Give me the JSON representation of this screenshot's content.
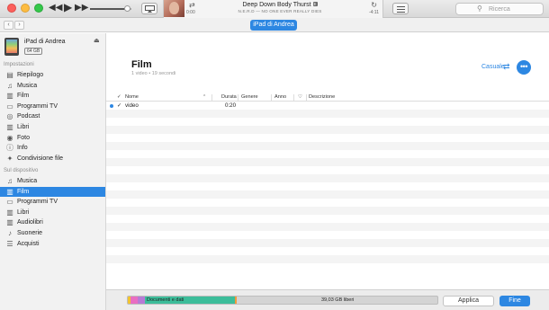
{
  "player": {
    "song_title": "Deep Down Body Thurst",
    "song_badge": "E",
    "artist_album": "N.E.R.D — NO ONE EVER REALLY DIES",
    "time_elapsed": "0:00",
    "time_remaining": "-4:11",
    "volume_fraction": 0.87,
    "search_placeholder": "Ricerca",
    "icons": [
      "rewind-icon",
      "play-icon",
      "fast-forward-icon",
      "airplay-icon",
      "shuffle-icon",
      "repeat-icon",
      "list-icon",
      "search-icon"
    ]
  },
  "nav": {
    "back": "‹",
    "forward": "›",
    "device_pill": "iPad di Andrea"
  },
  "sidebar": {
    "device_name": "iPad di Andrea",
    "device_capacity": "64 GB",
    "settings_title": "Impostazioni",
    "settings_items": [
      {
        "label": "Riepilogo",
        "icon": "summary-icon"
      },
      {
        "label": "Musica",
        "icon": "music-icon"
      },
      {
        "label": "Film",
        "icon": "film-icon"
      },
      {
        "label": "Programmi TV",
        "icon": "tv-icon"
      },
      {
        "label": "Podcast",
        "icon": "podcast-icon"
      },
      {
        "label": "Libri",
        "icon": "books-icon"
      },
      {
        "label": "Foto",
        "icon": "camera-icon"
      },
      {
        "label": "Info",
        "icon": "info-icon"
      },
      {
        "label": "Condivisione file",
        "icon": "file-sharing-icon"
      }
    ],
    "device_title": "Sul dispositivo",
    "device_items": [
      {
        "label": "Musica",
        "icon": "music-icon"
      },
      {
        "label": "Film",
        "icon": "film-icon",
        "active": true
      },
      {
        "label": "Programmi TV",
        "icon": "tv-icon"
      },
      {
        "label": "Libri",
        "icon": "books-icon"
      },
      {
        "label": "Audiolibri",
        "icon": "audiobooks-icon"
      },
      {
        "label": "Suonerie",
        "icon": "ringtones-icon"
      },
      {
        "label": "Acquisti",
        "icon": "purchases-icon"
      }
    ]
  },
  "main": {
    "title": "Film",
    "subtitle": "1 video • 19 secondi",
    "shuffle_label": "Casuale",
    "more_label": "•••",
    "columns": [
      "Nome",
      "Durata",
      "Genere",
      "Anno",
      "Descrizione"
    ],
    "rows": [
      {
        "checked": true,
        "name": "video",
        "duration": "0:20",
        "genre": "",
        "year": "",
        "description": "",
        "playing": true
      }
    ]
  },
  "footer": {
    "docs_label": "Documenti e dati",
    "free_label": "39,03 GB liberi",
    "apply_label": "Applica",
    "done_label": "Fine"
  },
  "colors": {
    "accent": "#2d87e2",
    "storage_yellow": "#f2c230",
    "storage_pink": "#e96ec2",
    "storage_purple": "#b77ad6",
    "storage_teal": "#3cbd9a",
    "storage_orange": "#f29a3a",
    "storage_free": "#d4d4d4"
  }
}
